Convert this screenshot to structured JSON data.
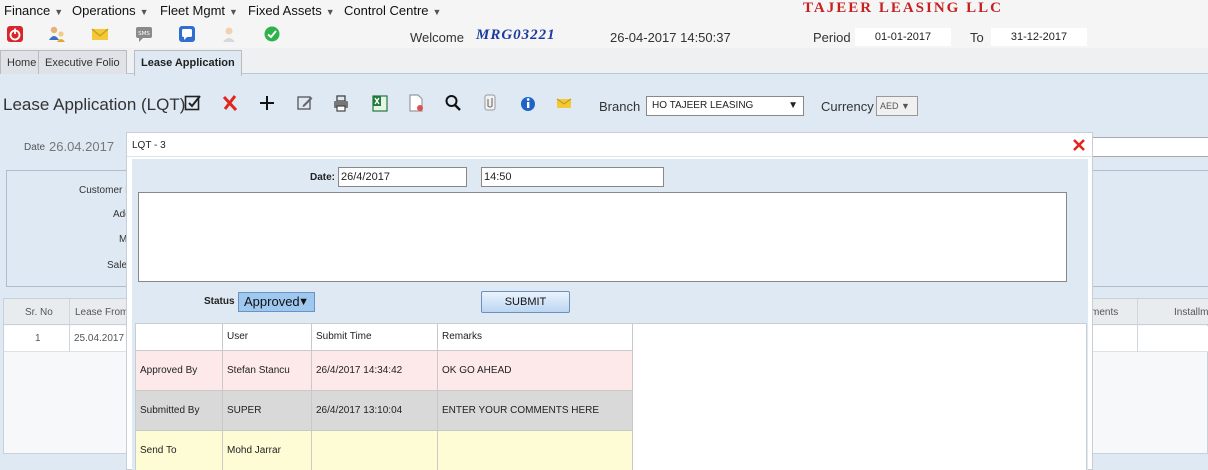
{
  "menu": [
    {
      "label": "Finance"
    },
    {
      "label": "Operations"
    },
    {
      "label": "Fleet Mgmt"
    },
    {
      "label": "Fixed Assets"
    },
    {
      "label": "Control Centre"
    }
  ],
  "company_name": "TAJEER LEASING LLC",
  "quick_icons": [
    "power-icon",
    "users-icon",
    "mail-icon",
    "sms-icon",
    "chat-icon",
    "user-icon",
    "check-icon"
  ],
  "header": {
    "welcome_label": "Welcome",
    "username": "MRG03221",
    "datetime": "26-04-2017 14:50:37",
    "period_label": "Period",
    "period_from": "01-01-2017",
    "to_label": "To",
    "period_to": "31-12-2017"
  },
  "tabs": [
    {
      "label": "Home"
    },
    {
      "label": "Executive Folio"
    },
    {
      "label": "Lease Application",
      "active": true
    }
  ],
  "toolbar": {
    "title": "Lease Application (LQT)",
    "icons": [
      "save-check-icon",
      "delete-icon",
      "add-icon",
      "edit-icon",
      "print-icon",
      "excel-icon",
      "document-icon",
      "search-icon",
      "attachment-icon",
      "info-icon",
      "email-icon"
    ],
    "branch_label": "Branch",
    "branch_value": "HO TAJEER LEASING",
    "currency_label": "Currency",
    "currency_value": "AED"
  },
  "background_form": {
    "date_label": "Date",
    "date_value": "26.04.2017",
    "fields": [
      "Customer N",
      "Add",
      "M",
      "Sale"
    ],
    "grid_headers": [
      "Sr. No",
      "Lease From",
      "ments",
      "Installm"
    ],
    "grid_row": [
      "1",
      "25.04.2017"
    ]
  },
  "modal": {
    "title": "LQT - 3",
    "date_label": "Date:",
    "date_value": "26/4/2017",
    "time_value": "14:50",
    "status_label": "Status",
    "status_value": "Approved",
    "submit_label": "SUBMIT",
    "table": {
      "headers": [
        "",
        "User",
        "Submit Time",
        "Remarks"
      ],
      "rows": [
        {
          "role": "Approved By",
          "user": "Stefan Stancu",
          "time": "26/4/2017 14:34:42",
          "remarks": "OK GO AHEAD",
          "color": "#fde9ea"
        },
        {
          "role": "Submitted By",
          "user": "SUPER",
          "time": "26/4/2017 13:10:04",
          "remarks": "ENTER YOUR COMMENTS HERE",
          "color": "#d9d9d9"
        },
        {
          "role": "Send To",
          "user": "Mohd Jarrar",
          "time": "",
          "remarks": "",
          "color": "#fdfcd5"
        }
      ]
    }
  }
}
